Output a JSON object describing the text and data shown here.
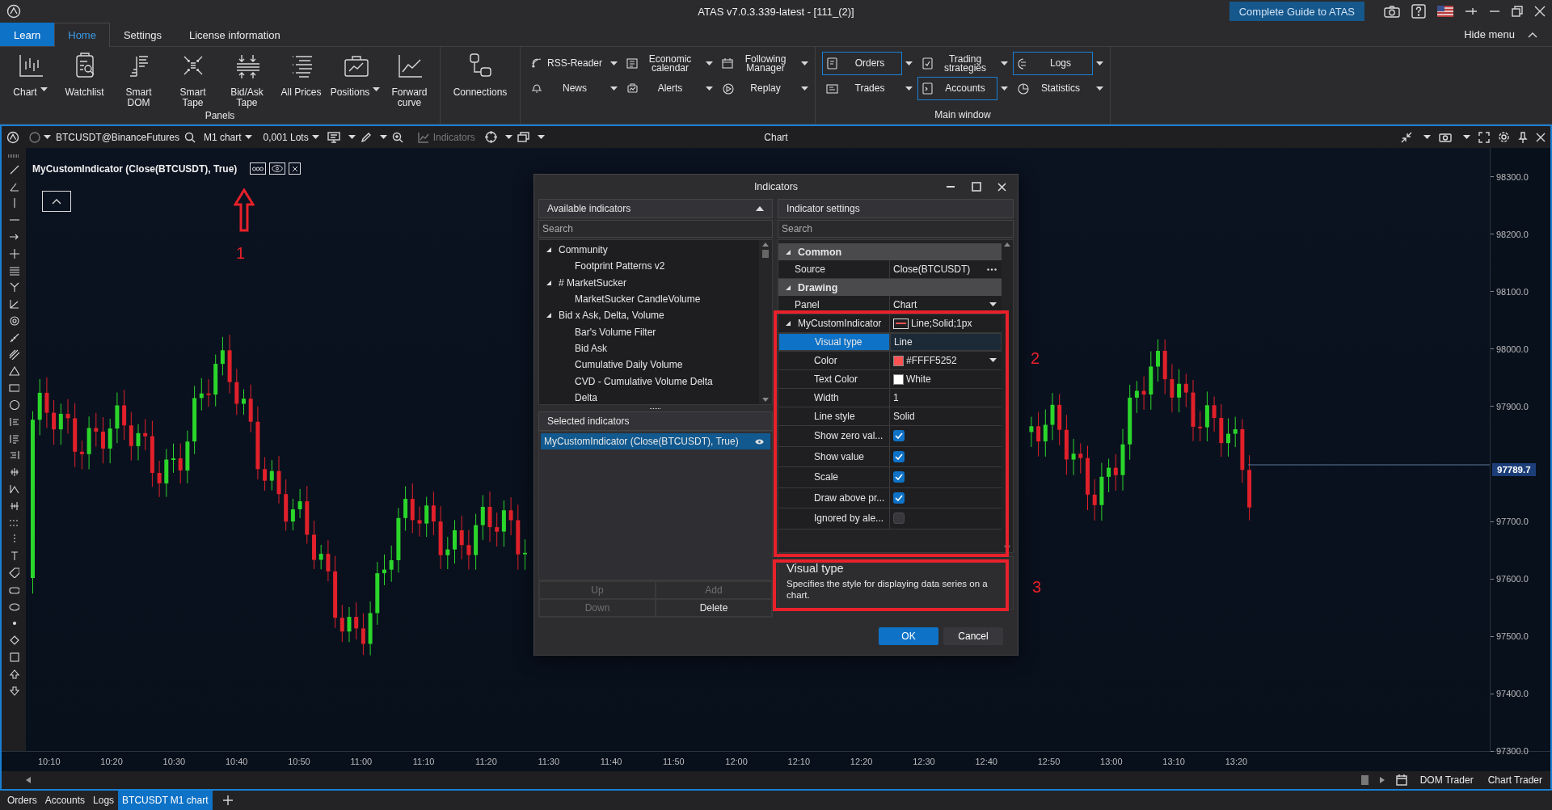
{
  "title_bar": {
    "title": "ATAS v7.0.3.339-latest - [111_(2)]",
    "guide_button": "Complete Guide to ATAS"
  },
  "ribbon": {
    "tabs": [
      {
        "label": "Learn",
        "kind": "accent",
        "selected": false
      },
      {
        "label": "Home",
        "kind": "plain",
        "selected": true
      },
      {
        "label": "Settings",
        "kind": "plain",
        "selected": false
      },
      {
        "label": "License information",
        "kind": "plain",
        "selected": false
      }
    ],
    "hide_menu": "Hide menu",
    "panels": {
      "label": "Panels",
      "buttons": [
        {
          "label": "Chart",
          "dropdown": true
        },
        {
          "label": "Watchlist",
          "dropdown": false
        },
        {
          "label": "Smart DOM",
          "dropdown": false
        },
        {
          "label": "Smart Tape",
          "dropdown": false
        },
        {
          "label": "Bid/Ask Tape",
          "dropdown": false
        },
        {
          "label": "All Prices",
          "dropdown": false
        },
        {
          "label": "Positions",
          "dropdown": true
        },
        {
          "label": "Forward curve",
          "dropdown": false
        }
      ]
    },
    "connections": {
      "label": "Connections"
    },
    "feeds": [
      {
        "label": "RSS-Reader"
      },
      {
        "label": "Economic calendar"
      },
      {
        "label": "Following Manager"
      },
      {
        "label": "News"
      },
      {
        "label": "Alerts"
      },
      {
        "label": "Replay"
      }
    ],
    "main_window": {
      "label": "Main window",
      "items": [
        {
          "label": "Orders",
          "selected": true
        },
        {
          "label": "Trading strategies",
          "selected": false
        },
        {
          "label": "Logs",
          "selected": true
        },
        {
          "label": "Trades",
          "selected": false
        },
        {
          "label": "Accounts",
          "selected": true
        },
        {
          "label": "Statistics",
          "selected": false
        }
      ]
    }
  },
  "chart": {
    "toolbar": {
      "symbol": "BTCUSDT@BinanceFutures",
      "timeframe": "M1 chart",
      "lots": "0,001 Lots",
      "indicators": "Indicators",
      "title": "Chart"
    },
    "indicator_label": "MyCustomIndicator (Close(BTCUSDT), True)",
    "price_ticks": [
      "98300.0",
      "98200.0",
      "98100.0",
      "98000.0",
      "97900.0",
      "97700.0",
      "97600.0",
      "97500.0",
      "97400.0",
      "97300.0"
    ],
    "current_price": "97789.7",
    "time_ticks": [
      "10:10",
      "10:20",
      "10:30",
      "10:40",
      "10:50",
      "11:00",
      "11:10",
      "11:20",
      "11:30",
      "11:40",
      "11:50",
      "12:00",
      "12:10",
      "12:20",
      "12:30",
      "12:40",
      "12:50",
      "13:00",
      "13:10",
      "13:20"
    ],
    "trader_buttons": [
      "DOM Trader",
      "Chart Trader"
    ],
    "annotations": [
      "1",
      "2",
      "3"
    ]
  },
  "dialog": {
    "title": "Indicators",
    "available": {
      "header": "Available indicators",
      "search_placeholder": "Search",
      "tree": [
        {
          "label": "Community",
          "expanded": true,
          "children": [
            {
              "label": "Footprint Patterns v2"
            }
          ]
        },
        {
          "label": "# MarketSucker",
          "expanded": true,
          "children": [
            {
              "label": "MarketSucker CandleVolume"
            }
          ]
        },
        {
          "label": "Bid x Ask, Delta, Volume",
          "expanded": true,
          "children": [
            {
              "label": "Bar's Volume Filter"
            },
            {
              "label": "Bid Ask"
            },
            {
              "label": "Cumulative Daily Volume"
            },
            {
              "label": "CVD - Cumulative Volume Delta"
            },
            {
              "label": "Delta"
            }
          ]
        }
      ]
    },
    "selected_list": {
      "header": "Selected indicators",
      "items": [
        {
          "label": "MyCustomIndicator (Close(BTCUSDT), True)",
          "selected": true
        }
      ]
    },
    "list_buttons": [
      {
        "label": "Up",
        "disabled": true
      },
      {
        "label": "Add",
        "disabled": true
      },
      {
        "label": "Down",
        "disabled": true
      },
      {
        "label": "Delete",
        "disabled": false
      }
    ],
    "settings": {
      "header": "Indicator settings",
      "search_placeholder": "Search",
      "groups": [
        {
          "label": "Common",
          "expanded": true,
          "rows": [
            {
              "name": "Source",
              "value": "Close(BTCUSDT)",
              "kind": "ellipsis"
            }
          ]
        },
        {
          "label": "Drawing",
          "expanded": true,
          "rows": [
            {
              "name": "Panel",
              "value": "Chart",
              "kind": "dropdown"
            },
            {
              "name": "MyCustomIndicator",
              "value": "Line;Solid;1px",
              "kind": "series",
              "expanded": true,
              "children": [
                {
                  "name": "Visual type",
                  "value": "Line",
                  "kind": "text",
                  "selected": true
                },
                {
                  "name": "Color",
                  "value": "#FFFF5252",
                  "kind": "color",
                  "color": "#ff5252",
                  "selected": false
                },
                {
                  "name": "Text Color",
                  "value": "White",
                  "kind": "color",
                  "color": "#ffffff",
                  "selected": false
                },
                {
                  "name": "Width",
                  "value": "1",
                  "kind": "text",
                  "selected": false
                },
                {
                  "name": "Line style",
                  "value": "Solid",
                  "kind": "text",
                  "selected": false
                },
                {
                  "name": "Show zero val...",
                  "kind": "checkbox",
                  "checked": true,
                  "selected": false
                },
                {
                  "name": "Show value",
                  "kind": "checkbox",
                  "checked": true,
                  "selected": false
                },
                {
                  "name": "Scale",
                  "kind": "checkbox",
                  "checked": true,
                  "selected": false
                },
                {
                  "name": "Draw above pr...",
                  "kind": "checkbox",
                  "checked": true,
                  "selected": false
                },
                {
                  "name": "Ignored by ale...",
                  "kind": "checkbox",
                  "checked": false,
                  "selected": false
                }
              ]
            }
          ]
        }
      ]
    },
    "help": {
      "title": "Visual type",
      "text": "Specifies the style for displaying data series on a chart."
    },
    "buttons": [
      {
        "label": "OK",
        "kind": "primary"
      },
      {
        "label": "Cancel",
        "kind": "secondary"
      }
    ]
  },
  "bottom_tabs": [
    {
      "label": "Orders",
      "selected": false
    },
    {
      "label": "Accounts",
      "selected": false
    },
    {
      "label": "Logs",
      "selected": false
    },
    {
      "label": "BTCUSDT M1 chart",
      "selected": true
    }
  ]
}
